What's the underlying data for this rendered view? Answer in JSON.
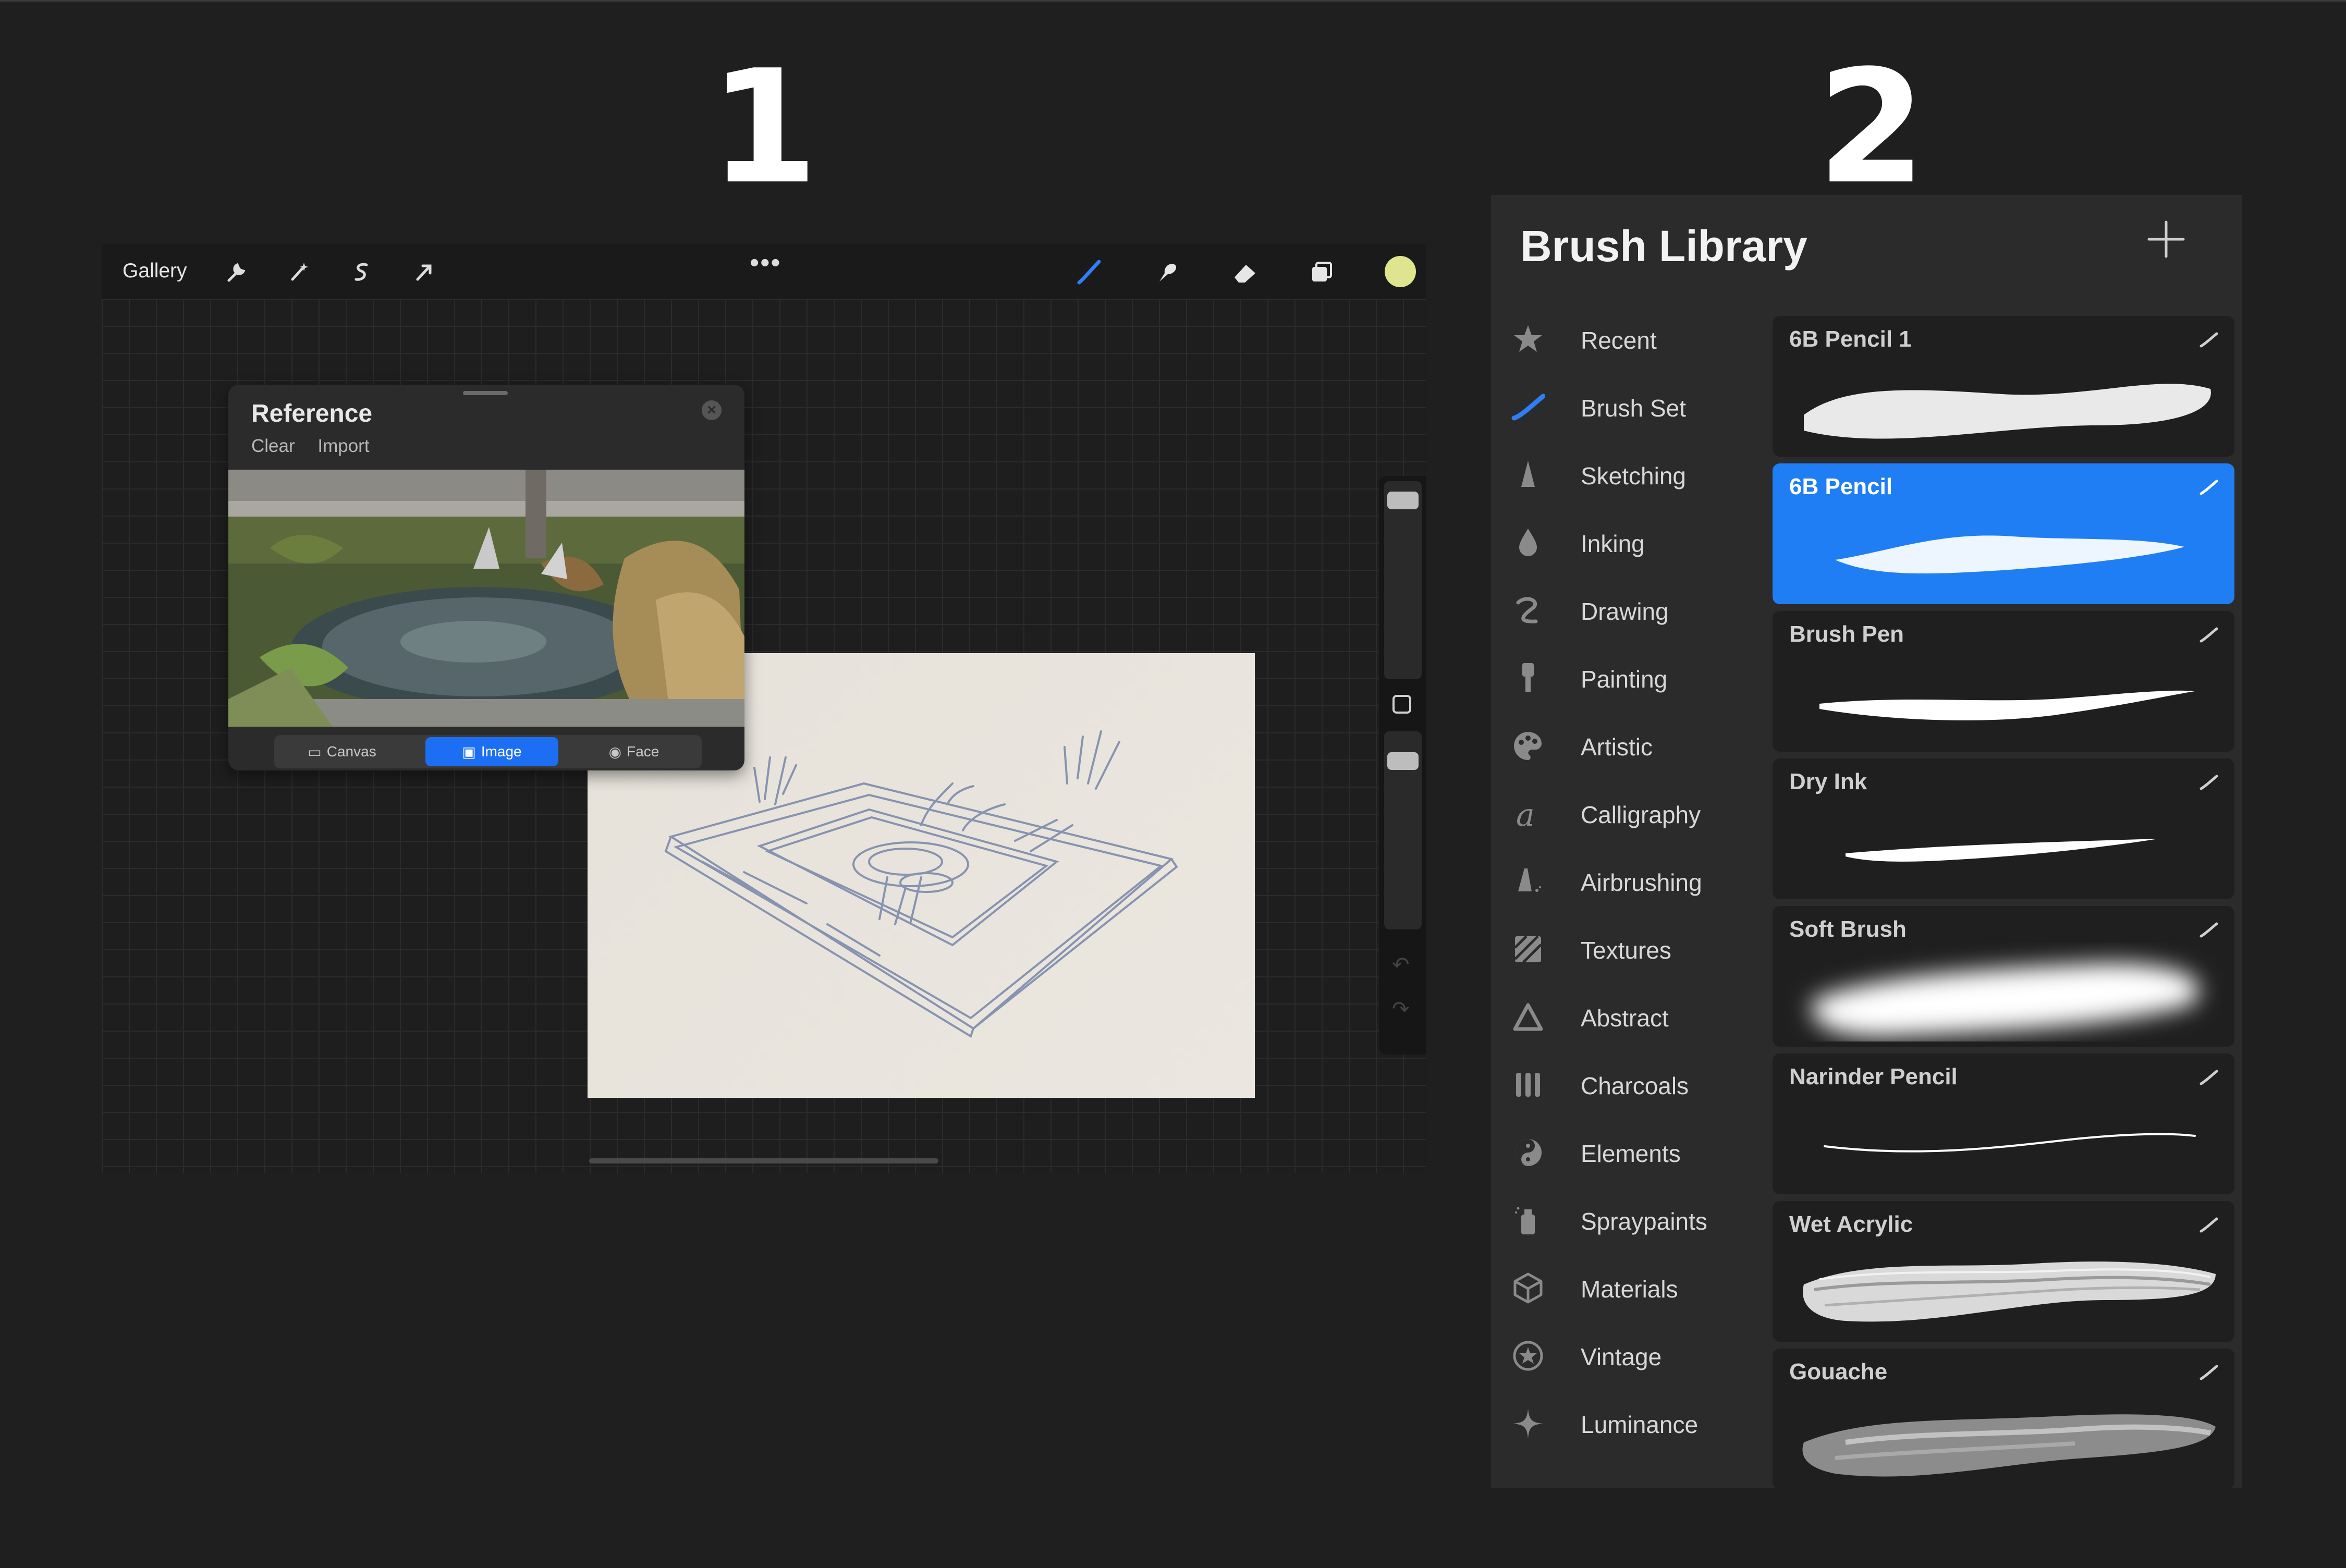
{
  "labels": {
    "panel1_number": "1",
    "panel2_number": "2"
  },
  "canvas_app": {
    "toolbar": {
      "gallery_label": "Gallery",
      "left_icons": [
        "wrench-icon",
        "magic-wand-icon",
        "selection-icon",
        "transform-arrow-icon"
      ],
      "more_icon": "•••",
      "right_icons": [
        "brush-icon",
        "smudge-icon",
        "eraser-icon",
        "layers-icon"
      ],
      "current_color": "#dfe48e"
    },
    "reference": {
      "title": "Reference",
      "clear_label": "Clear",
      "import_label": "Import",
      "tabs": [
        {
          "label": "Canvas",
          "active": false
        },
        {
          "label": "Image",
          "active": true
        },
        {
          "label": "Face",
          "active": false
        }
      ]
    },
    "sidebar": {
      "undo_icon": "↶",
      "redo_icon": "↷"
    }
  },
  "brush_library": {
    "title": "Brush Library",
    "add_icon": "plus-icon",
    "categories": [
      {
        "label": "Recent",
        "icon": "star-icon"
      },
      {
        "label": "Brush Set",
        "icon": "brush-set-icon"
      },
      {
        "label": "Sketching",
        "icon": "pencil-tip-icon"
      },
      {
        "label": "Inking",
        "icon": "ink-drop-icon"
      },
      {
        "label": "Drawing",
        "icon": "squiggle-icon"
      },
      {
        "label": "Painting",
        "icon": "paintbrush-icon"
      },
      {
        "label": "Artistic",
        "icon": "palette-icon"
      },
      {
        "label": "Calligraphy",
        "icon": "calligraphy-a-icon"
      },
      {
        "label": "Airbrushing",
        "icon": "airbrush-icon"
      },
      {
        "label": "Textures",
        "icon": "texture-icon"
      },
      {
        "label": "Abstract",
        "icon": "triangle-icon"
      },
      {
        "label": "Charcoals",
        "icon": "charcoal-icon"
      },
      {
        "label": "Elements",
        "icon": "yin-yang-icon"
      },
      {
        "label": "Spraypaints",
        "icon": "spray-can-icon"
      },
      {
        "label": "Materials",
        "icon": "cube-icon"
      },
      {
        "label": "Vintage",
        "icon": "vintage-star-icon"
      },
      {
        "label": "Luminance",
        "icon": "sparkle-icon"
      }
    ],
    "brushes": [
      {
        "name": "6B Pencil 1",
        "selected": false
      },
      {
        "name": "6B Pencil",
        "selected": true
      },
      {
        "name": "Brush Pen",
        "selected": false
      },
      {
        "name": "Dry Ink",
        "selected": false
      },
      {
        "name": "Soft Brush",
        "selected": false
      },
      {
        "name": "Narinder Pencil",
        "selected": false
      },
      {
        "name": "Wet Acrylic",
        "selected": false
      },
      {
        "name": "Gouache",
        "selected": false
      }
    ],
    "selected_color": "#1f7ef4"
  }
}
